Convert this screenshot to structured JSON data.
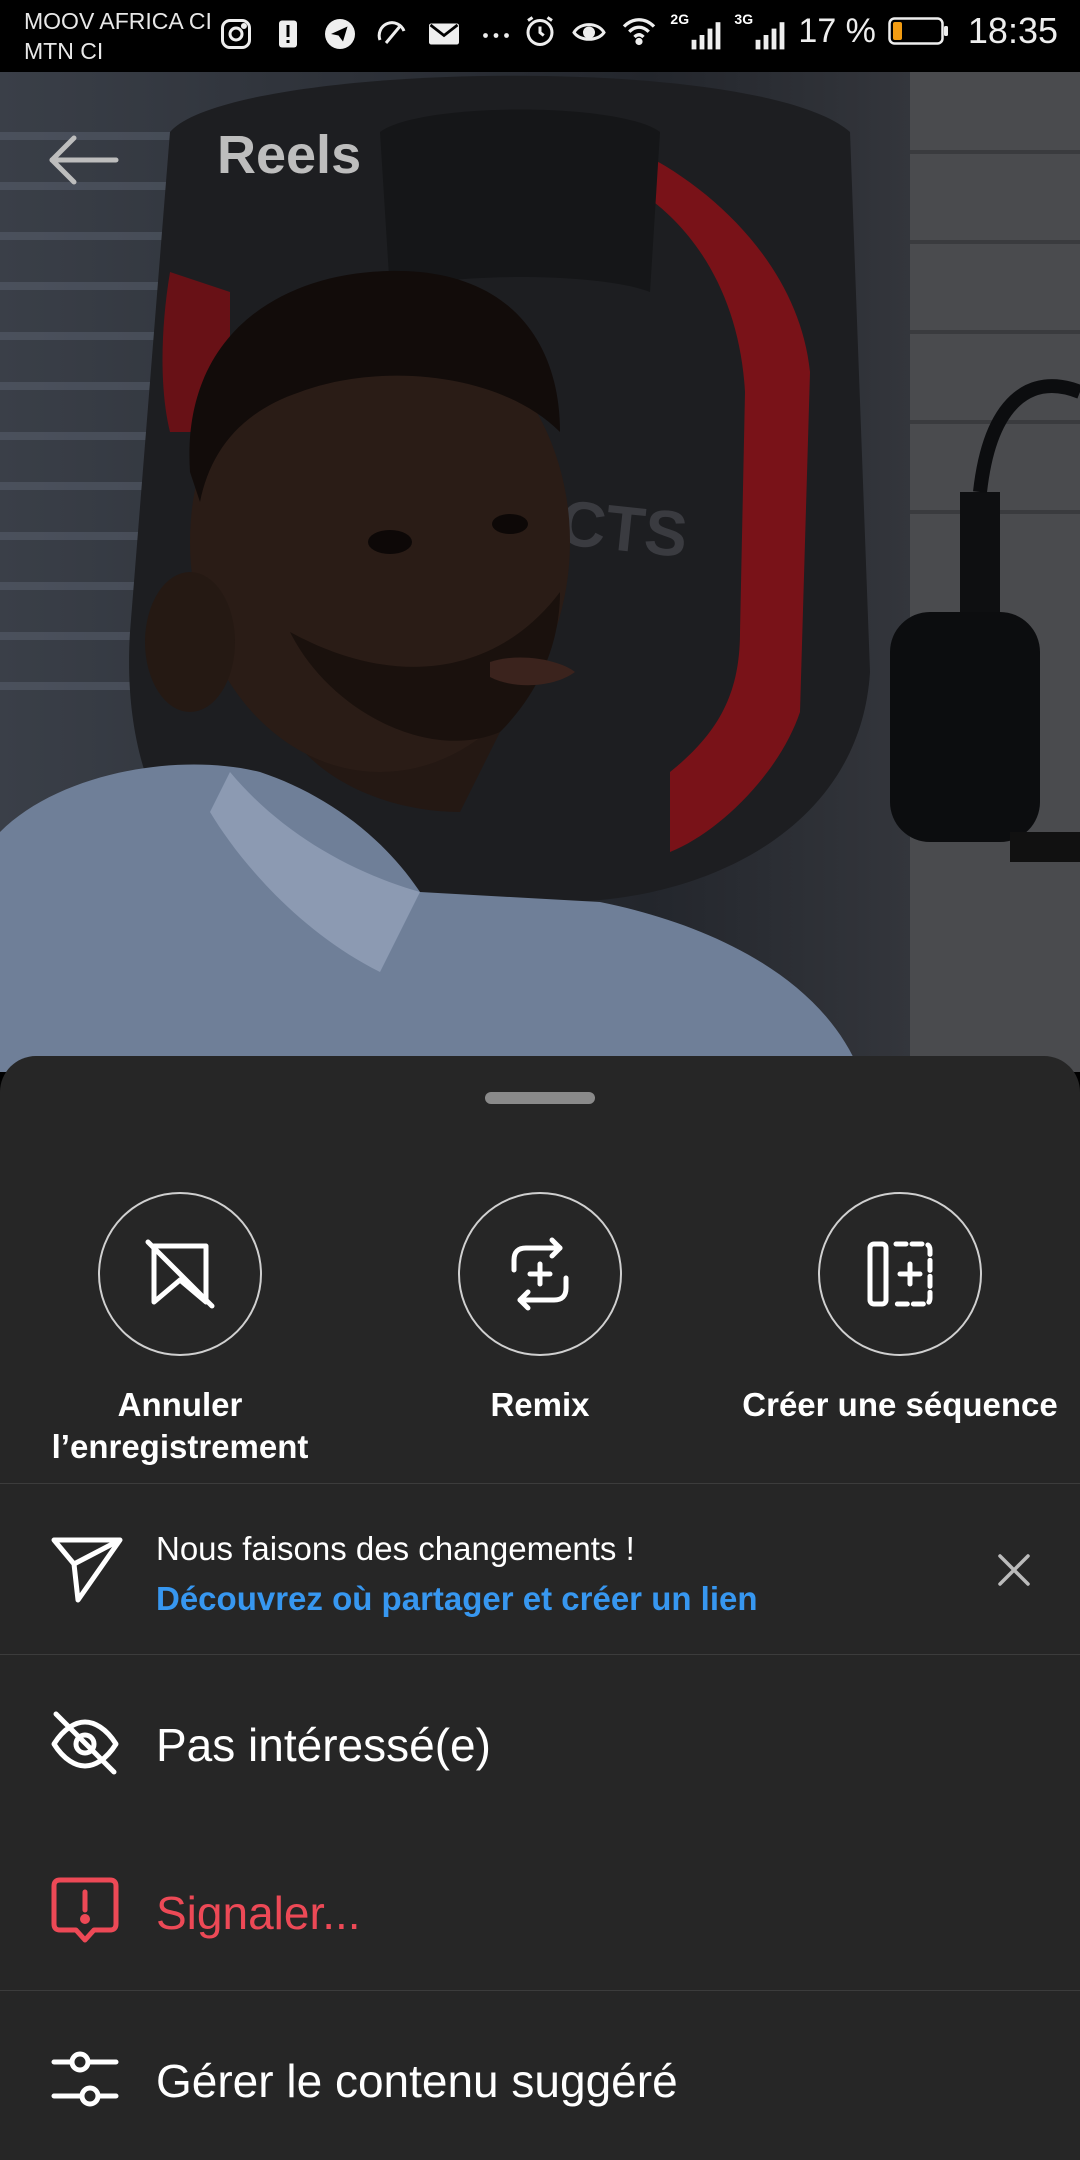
{
  "status_bar": {
    "carrier_1": "MOOV AFRICA CI",
    "carrier_2": "MTN CI",
    "network_1": "2G",
    "network_2": "3G",
    "battery": "17 %",
    "time": "18:35"
  },
  "header": {
    "title": "Reels"
  },
  "sheet": {
    "actions": [
      {
        "label_line1": "Annuler",
        "label_line2": "l’enregistrement",
        "icon": "unsave-bookmark-icon"
      },
      {
        "label": "Remix",
        "icon": "remix-icon"
      },
      {
        "label": "Créer une séquence",
        "icon": "create-sequence-icon"
      }
    ],
    "notice": {
      "title": "Nous faisons des changements !",
      "link": "Découvrez où partager et créer un lien"
    },
    "menu": [
      {
        "label": "Pas intéressé(e)",
        "icon": "eye-off-icon"
      },
      {
        "label": "Signaler...",
        "icon": "report-icon",
        "color": "#ed4956"
      },
      {
        "label": "Gérer le contenu suggéré",
        "icon": "sliders-icon"
      }
    ]
  },
  "colors": {
    "sheet_bg": "#262626",
    "link_blue": "#3797f0",
    "danger_red": "#ed4956"
  }
}
